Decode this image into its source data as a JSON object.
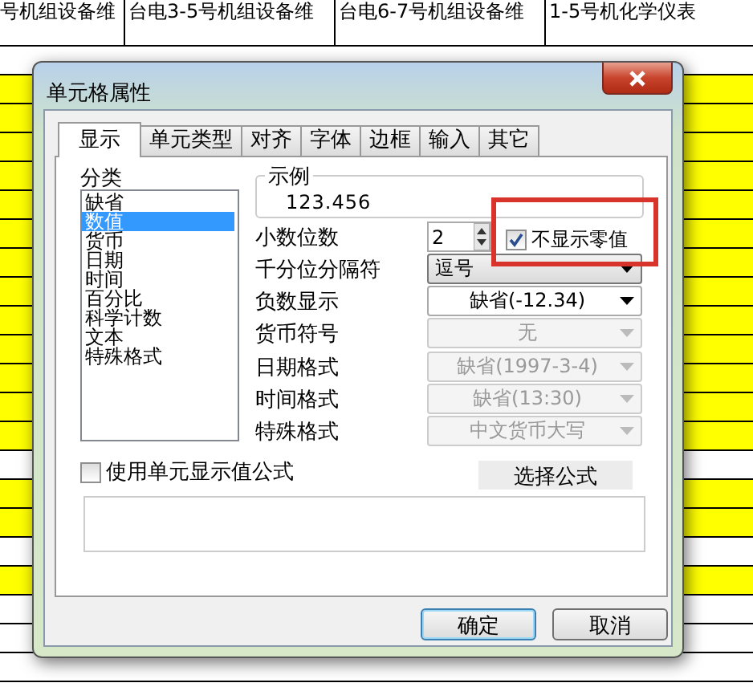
{
  "sheet": {
    "headers": [
      "号机组设备维",
      "台电3-5号机组设备维",
      "台电6-7号机组设备维",
      "1-5号机化学仪表"
    ],
    "rows": [
      {
        "highlighted": false
      },
      {
        "highlighted": true
      },
      {
        "highlighted": true
      },
      {
        "highlighted": true
      },
      {
        "highlighted": true
      },
      {
        "highlighted": true
      },
      {
        "highlighted": true
      },
      {
        "highlighted": true
      },
      {
        "highlighted": true
      },
      {
        "highlighted": true
      },
      {
        "highlighted": true
      },
      {
        "highlighted": true
      },
      {
        "highlighted": true
      },
      {
        "highlighted": true
      },
      {
        "highlighted": false
      },
      {
        "highlighted": true
      },
      {
        "highlighted": true
      },
      {
        "highlighted": false
      },
      {
        "highlighted": true
      },
      {
        "highlighted": false
      },
      {
        "highlighted": false
      },
      {
        "highlighted": false
      }
    ]
  },
  "dialog": {
    "title": "单元格属性",
    "tabs": [
      {
        "label": "显示",
        "selected": true
      },
      {
        "label": "单元类型",
        "selected": false
      },
      {
        "label": "对齐",
        "selected": false
      },
      {
        "label": "字体",
        "selected": false
      },
      {
        "label": "边框",
        "selected": false
      },
      {
        "label": "输入",
        "selected": false
      },
      {
        "label": "其它",
        "selected": false
      }
    ],
    "category_label": "分类",
    "categories": [
      {
        "label": "缺省",
        "selected": false
      },
      {
        "label": "数值",
        "selected": true
      },
      {
        "label": "货币",
        "selected": false
      },
      {
        "label": "日期",
        "selected": false
      },
      {
        "label": "时间",
        "selected": false
      },
      {
        "label": "百分比",
        "selected": false
      },
      {
        "label": "科学计数",
        "selected": false
      },
      {
        "label": "文本",
        "selected": false
      },
      {
        "label": "特殊格式",
        "selected": false
      }
    ],
    "sample": {
      "legend": "示例",
      "value": "123.456"
    },
    "fields": [
      {
        "label": "小数位数",
        "kind": "spinner",
        "value": "2"
      },
      {
        "label": "千分位分隔符",
        "kind": "droplist",
        "value": "逗号",
        "disabled": false
      },
      {
        "label": "负数显示",
        "kind": "combo",
        "value": "缺省(-12.34)",
        "disabled": false
      },
      {
        "label": "货币符号",
        "kind": "combo",
        "value": "无",
        "disabled": true
      },
      {
        "label": "日期格式",
        "kind": "combo",
        "value": "缺省(1997-3-4)",
        "disabled": true
      },
      {
        "label": "时间格式",
        "kind": "combo",
        "value": "缺省(13:30)",
        "disabled": true
      },
      {
        "label": "特殊格式",
        "kind": "combo",
        "value": "中文货币大写",
        "disabled": true
      }
    ],
    "zero_checkbox": {
      "label": "不显示零值",
      "checked": true
    },
    "formula_checkbox": {
      "label": "使用单元显示值公式",
      "checked": false
    },
    "formula_button": "选择公式",
    "buttons": [
      {
        "label": "确定",
        "default": true
      },
      {
        "label": "取消",
        "default": false
      }
    ]
  }
}
